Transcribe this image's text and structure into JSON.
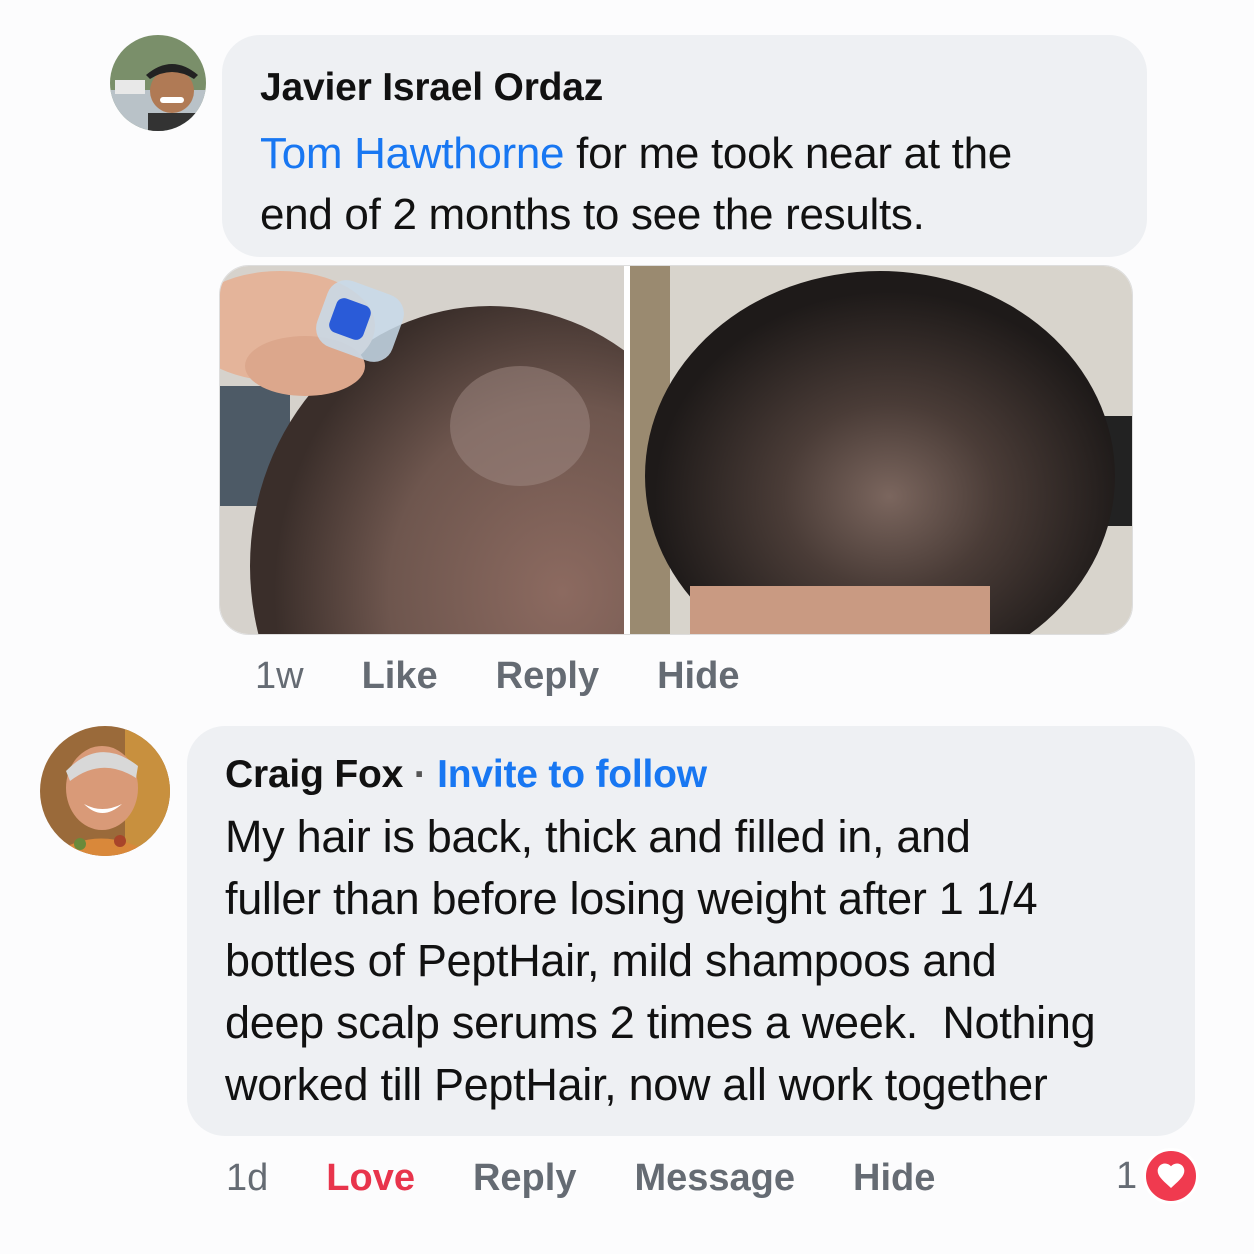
{
  "comments": [
    {
      "author": "Javier Israel Ordaz",
      "mention": "Tom Hawthorne",
      "text_line1": " for me took near at the",
      "text_line2": "end of 2 months to see the results.",
      "photos": [
        "scalp-before-photo",
        "scalp-after-photo"
      ],
      "time": "1w",
      "actions": {
        "like": "Like",
        "reply": "Reply",
        "hide": "Hide"
      }
    },
    {
      "author": "Craig Fox",
      "separator": "·",
      "follow_link": "Invite to follow",
      "lines": [
        "My hair is back, thick and filled in, and",
        "fuller than before losing weight after 1 1/4",
        "bottles of PeptHair, mild shampoos and",
        "deep scalp serums 2 times a week.  Nothing",
        "worked till PeptHair, now all work together"
      ],
      "time": "1d",
      "actions": {
        "love": "Love",
        "reply": "Reply",
        "message": "Message",
        "hide": "Hide"
      },
      "reaction_count": "1",
      "reaction_icon": "heart-icon"
    }
  ],
  "colors": {
    "link": "#1877f2",
    "love": "#e8344c",
    "bubble": "#eef0f3",
    "meta": "#656b73"
  }
}
